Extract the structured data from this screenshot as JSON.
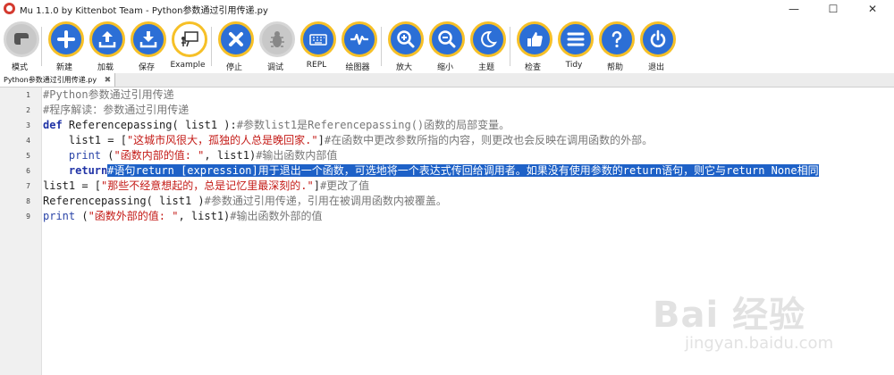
{
  "window": {
    "title": "Mu 1.1.0 by Kittenbot Team - Python参数通过引用传递.py",
    "controls": [
      "—",
      "☐",
      "✕"
    ]
  },
  "toolbar": {
    "accent": "#2c6fd6",
    "ring": "#f6c027",
    "buttons": [
      {
        "id": "mode",
        "label": "模式",
        "icon": "mode-icon"
      },
      {
        "id": "new",
        "label": "新建",
        "icon": "plus-icon"
      },
      {
        "id": "load",
        "label": "加载",
        "icon": "upload-icon"
      },
      {
        "id": "save",
        "label": "保存",
        "icon": "download-icon"
      },
      {
        "id": "example",
        "label": "Example",
        "icon": "presentation-icon"
      },
      {
        "id": "stop",
        "label": "停止",
        "icon": "close-icon"
      },
      {
        "id": "debug",
        "label": "调试",
        "icon": "bug-icon"
      },
      {
        "id": "repl",
        "label": "REPL",
        "icon": "keyboard-icon"
      },
      {
        "id": "plotter",
        "label": "绘图器",
        "icon": "wave-icon"
      },
      {
        "id": "zoom-in",
        "label": "放大",
        "icon": "zoom-in-icon"
      },
      {
        "id": "zoom-out",
        "label": "缩小",
        "icon": "zoom-out-icon"
      },
      {
        "id": "theme",
        "label": "主题",
        "icon": "moon-icon"
      },
      {
        "id": "check",
        "label": "检查",
        "icon": "thumbs-up-icon"
      },
      {
        "id": "tidy",
        "label": "Tidy",
        "icon": "lines-icon"
      },
      {
        "id": "help",
        "label": "帮助",
        "icon": "question-icon"
      },
      {
        "id": "quit",
        "label": "退出",
        "icon": "power-icon"
      }
    ]
  },
  "tab": {
    "name": "Python参数通过引用传递.py",
    "close": "✖"
  },
  "editor": {
    "line_numbers": [
      "1",
      "2",
      "3",
      "4",
      "5",
      "6",
      "7",
      "8",
      "9"
    ],
    "l1": {
      "comment": "#Python参数通过引用传递"
    },
    "l2": {
      "comment": "#程序解读：参数通过引用传递"
    },
    "l3": {
      "kw": "def",
      "name": " Referencepassing( list1 ):",
      "comment": "#参数list1是Referencepassing()函数的局部变量。"
    },
    "l4": {
      "indent": "    ",
      "code": "list1 = [",
      "str": "\"这城市风很大，孤独的人总是晚回家.\"",
      "code2": "]",
      "comment": "#在函数中更改参数所指的内容，则更改也会反映在调用函数的外部。"
    },
    "l5": {
      "indent": "    ",
      "bi": "print",
      "code": " (",
      "str": "\"函数内部的值: \"",
      "code2": ", list1)",
      "comment": "#输出函数内部值"
    },
    "l6": {
      "indent": "    ",
      "kw": "return",
      "selected": "#语句return [expression]用于退出一个函数，可选地将一个表达式传回给调用者。如果没有使用参数的return语句，则它与return None相同"
    },
    "l7": {
      "code": "list1 = [",
      "str": "\"那些不经意想起的，总是记忆里最深刻的.\"",
      "code2": "]",
      "comment": "#更改了值"
    },
    "l8": {
      "code": "Referencepassing( list1 )",
      "comment": "#参数通过引用传递，引用在被调用函数内被覆盖。"
    },
    "l9": {
      "bi": "print",
      "code": " (",
      "str": "\"函数外部的值: \"",
      "code2": ", list1)",
      "comment": "#输出函数外部的值"
    }
  },
  "watermark": {
    "brand": "Bai 经验",
    "url": "jingyan.baidu.com"
  }
}
